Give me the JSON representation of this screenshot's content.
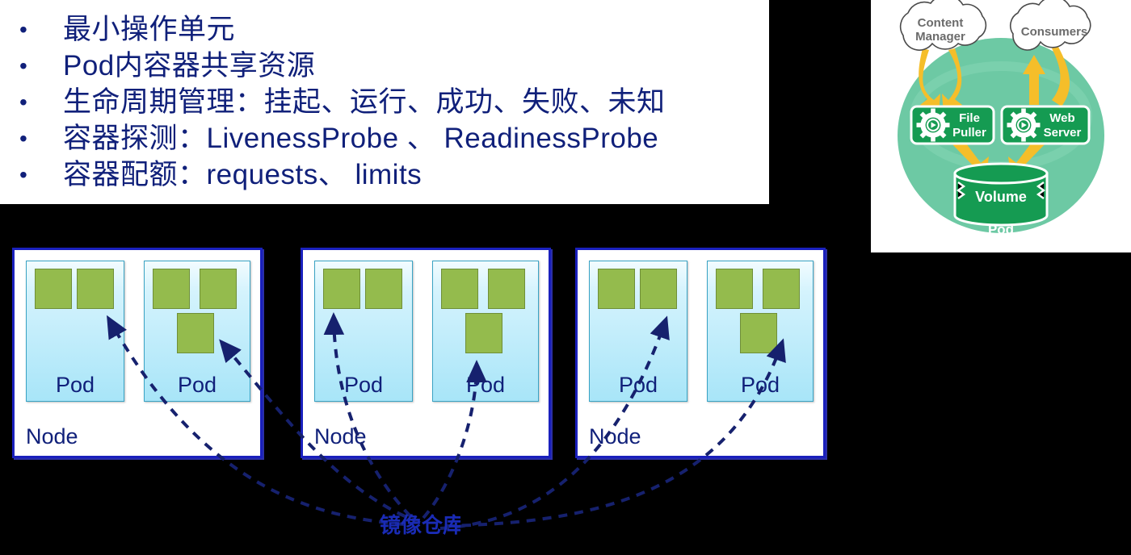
{
  "slide": {
    "background_color": "#000000",
    "accent_color": "#10207a",
    "node_border_color": "#1a20bd",
    "container_color": "#94bb4d",
    "pod_color": "#a8e5f8"
  },
  "bullets": {
    "items": [
      {
        "marker": "•",
        "text": "最小操作单元"
      },
      {
        "marker": "•",
        "text": "Pod内容器共享资源"
      },
      {
        "marker": "•",
        "text": "生命周期管理：挂起、运行、成功、失败、未知"
      },
      {
        "marker": "•",
        "text": "容器探测：LivenessProbe 、 ReadinessProbe"
      },
      {
        "marker": "•",
        "text": "容器配额：requests、 limits"
      }
    ]
  },
  "pod_architecture": {
    "clouds": [
      {
        "line1": "Content",
        "line2": "Manager"
      },
      {
        "line1": "Consumers",
        "line2": ""
      }
    ],
    "containers": [
      {
        "line1": "File",
        "line2": "Puller"
      },
      {
        "line1": "Web",
        "line2": "Server"
      }
    ],
    "volume_label": "Volume",
    "pod_label": "Pod",
    "colors": {
      "pod_circle": "#6dc9a4",
      "container_box": "#159b52",
      "arrow": "#f5be2a",
      "cloud_text": "#6b6b6b"
    }
  },
  "nodes": [
    {
      "label": "Node",
      "pods": [
        {
          "label": "Pod",
          "containers": 2
        },
        {
          "label": "Pod",
          "containers": 3
        }
      ]
    },
    {
      "label": "Node",
      "pods": [
        {
          "label": "Pod",
          "containers": 2
        },
        {
          "label": "Pod",
          "containers": 3
        }
      ]
    },
    {
      "label": "Node",
      "pods": [
        {
          "label": "Pod",
          "containers": 2
        },
        {
          "label": "Pod",
          "containers": 3
        }
      ]
    }
  ],
  "hub": {
    "label": "镜像仓库"
  }
}
